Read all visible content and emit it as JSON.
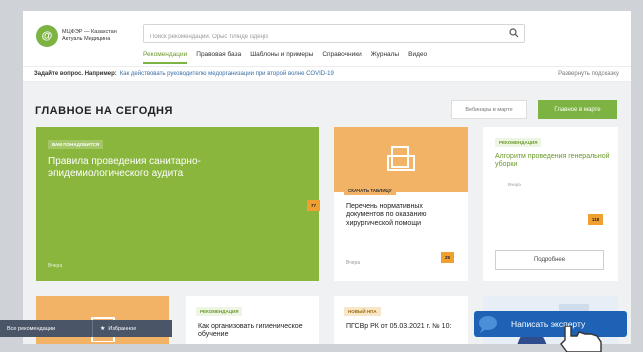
{
  "logo": {
    "mark": "@",
    "line1": "МЦФЭР — Казахстан",
    "line2": "Актуаль Медицина"
  },
  "search": {
    "placeholder": "Поиск рекомендаций. Орыс тілінде іздеңіз"
  },
  "nav": {
    "items": [
      "Рекомендации",
      "Правовая база",
      "Шаблоны и примеры",
      "Справочники",
      "Журналы",
      "Видео"
    ]
  },
  "quick_question": {
    "label": "Задайте вопрос. Например:",
    "link": "Как действовать руководителю медорганизации при второй волне COVID-19",
    "expand": "Развернуть подсказку"
  },
  "section": {
    "title": "ГЛАВНОЕ НА СЕГОДНЯ",
    "btn_webinars": "Вебинары в марте",
    "btn_main": "Главное в марте"
  },
  "cards": {
    "c1": {
      "badge": "ВАМ ПОНАДОБИТСЯ",
      "title": "Правила проведения санитарно-эпидемиологического аудита",
      "count": "77",
      "date": "Вчера"
    },
    "c2": {
      "badge": "СКАЧАТЬ ТАБЛИЦУ",
      "title": "Перечень нормативных документов по оказанию хирургической помощи",
      "count": "25",
      "date": "Вчера"
    },
    "c3": {
      "badge": "РЕКОМЕНДАЦИЯ",
      "title": "Алгоритм проведения генеральной уборки",
      "date": "Вчера",
      "count": "118",
      "button": "Подробнее"
    },
    "c5": {
      "badge": "РЕКОМЕНДАЦИЯ",
      "title": "Как организовать гигиеническое обучение"
    },
    "c6": {
      "badge": "НОВЫЙ НПА",
      "title": "ПГСВр РК от 05.03.2021 г. № 10:"
    }
  },
  "bottom": {
    "all": "Все рекомендации",
    "fav": "Избранное"
  },
  "expert": {
    "label": "Написать эксперту"
  },
  "colors": {
    "accent_green": "#7cb342",
    "orange": "#f3b366",
    "blue": "#1e62b5"
  }
}
